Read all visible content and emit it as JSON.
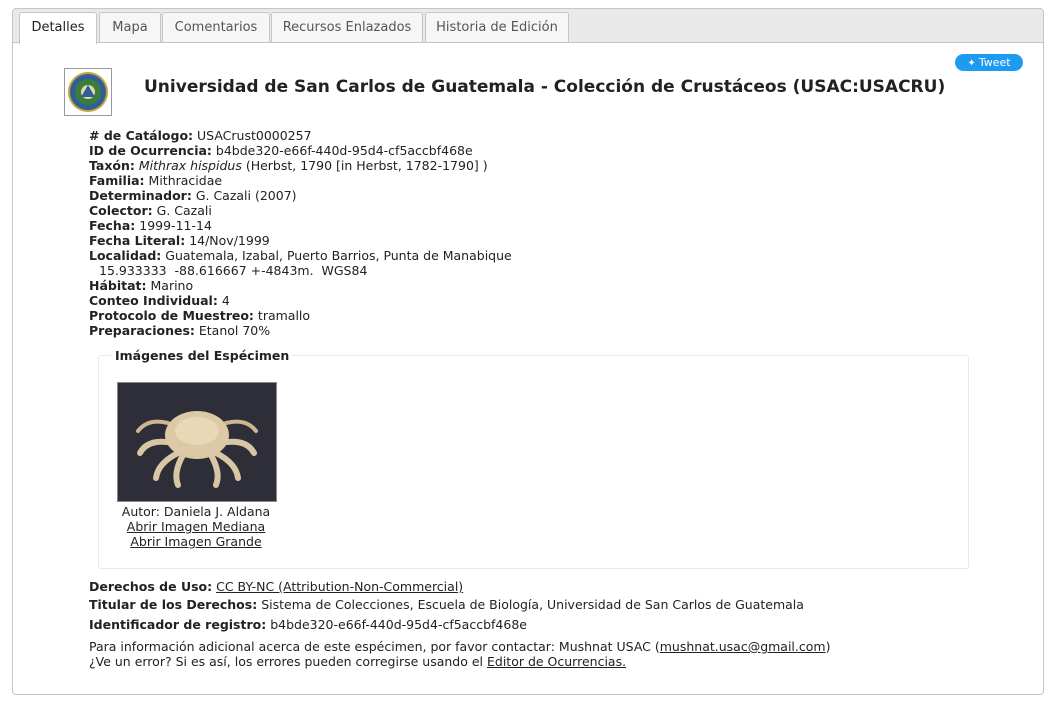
{
  "tabs": [
    {
      "label": "Detalles"
    },
    {
      "label": "Mapa"
    },
    {
      "label": "Comentarios"
    },
    {
      "label": "Recursos Enlazados"
    },
    {
      "label": "Historia de Edición"
    }
  ],
  "tweet_label": "Tweet",
  "title": "Universidad de San Carlos de Guatemala - Colección de Crustáceos (USAC:USACRU)",
  "fields": {
    "catalog": {
      "label": "# de Catálogo:",
      "value": "USACrust0000257"
    },
    "occurrence_id": {
      "label": "ID de Ocurrencia:",
      "value": "b4bde320-e66f-440d-95d4-cf5accbf468e"
    },
    "taxon": {
      "label": "Taxón:",
      "name": "Mithrax hispidus",
      "author": "(Herbst, 1790 [in Herbst, 1782-1790] )"
    },
    "family": {
      "label": "Familia:",
      "value": "Mithracidae"
    },
    "determiner": {
      "label": "Determinador:",
      "value": "G. Cazali (2007)"
    },
    "collector": {
      "label": "Colector:",
      "value": "G. Cazali"
    },
    "date": {
      "label": "Fecha:",
      "value": "1999-11-14"
    },
    "verbatim_date": {
      "label": "Fecha Literal:",
      "value": "14/Nov/1999"
    },
    "locality": {
      "label": "Localidad:",
      "value": "Guatemala, Izabal, Puerto Barrios, Punta de Manabique",
      "coords": "15.933333  -88.616667 +-4843m.  WGS84"
    },
    "habitat": {
      "label": "Hábitat:",
      "value": "Marino"
    },
    "count": {
      "label": "Conteo Individual:",
      "value": "4"
    },
    "protocol": {
      "label": "Protocolo de Muestreo:",
      "value": "tramallo"
    },
    "preparations": {
      "label": "Preparaciones:",
      "value": "Etanol 70%"
    }
  },
  "images": {
    "legend": "Imágenes del Espécimen",
    "author": "Autor: Daniela J. Aldana",
    "medium_link": "Abrir Imagen Mediana",
    "large_link": "Abrir Imagen Grande"
  },
  "rights": {
    "usage_label": "Derechos de Uso:",
    "usage_link": "CC BY-NC (Attribution-Non-Commercial)",
    "holder_label": "Titular de los Derechos:",
    "holder_value": "Sistema de Colecciones, Escuela de Biología, Universidad de San Carlos de Guatemala",
    "record_label": "Identificador de registro:",
    "record_value": "b4bde320-e66f-440d-95d4-cf5accbf468e"
  },
  "contact": {
    "line1_text": "Para información adicional acerca de este espécimen, por favor contactar: Mushnat USAC (",
    "email": "mushnat.usac@gmail.com",
    "line1_end": ")",
    "line2_text": "¿Ve un error? Si es así, los errores pueden corregirse usando el ",
    "editor_link": "Editor de Ocurrencias."
  }
}
